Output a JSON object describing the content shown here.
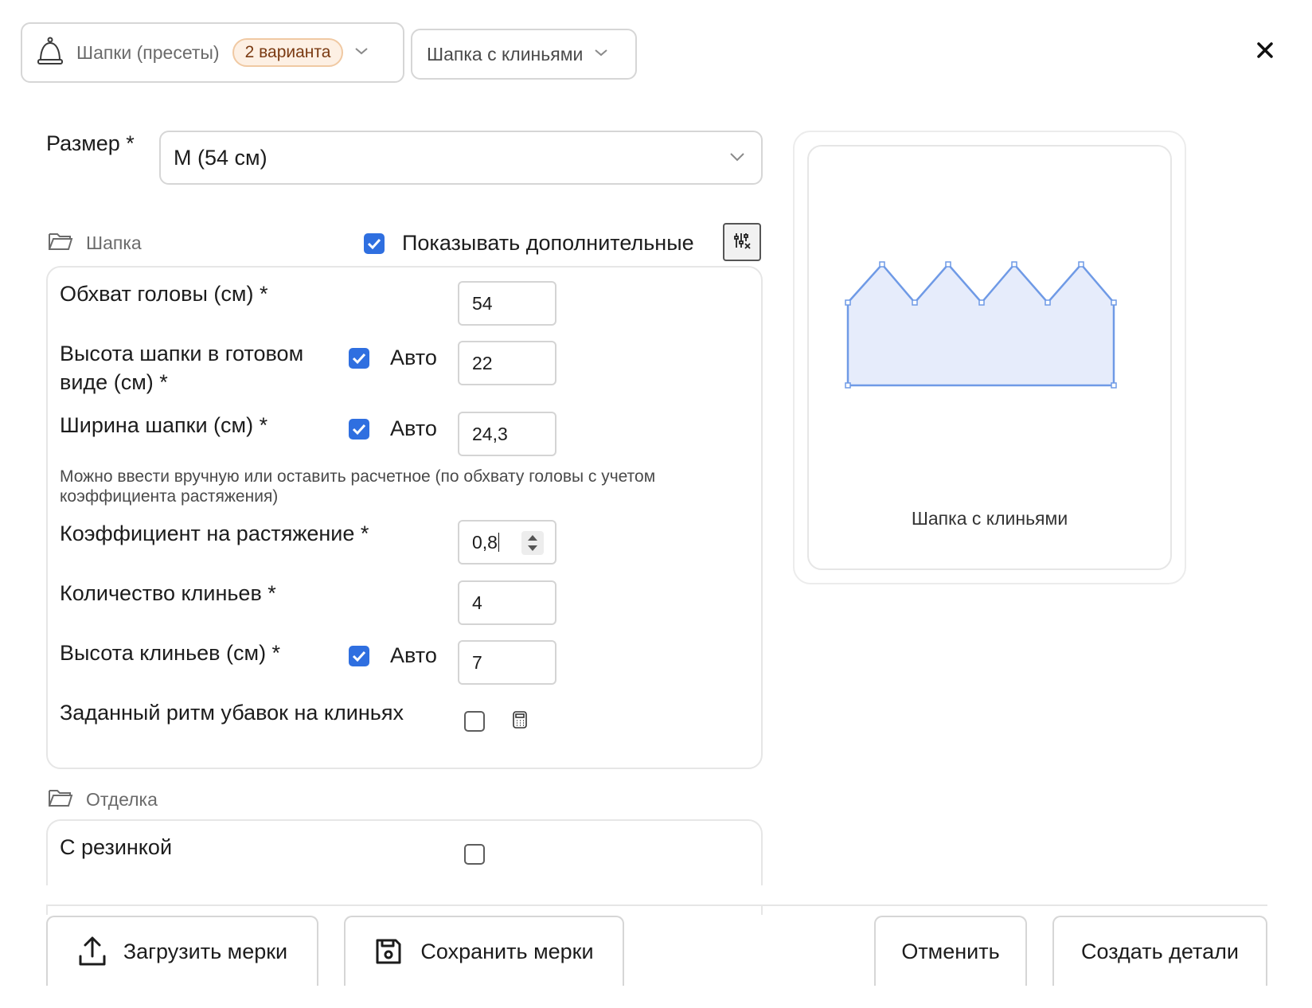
{
  "header": {
    "preset_label": "Шапки (пресеты)",
    "preset_badge": "2 варианта",
    "variant_label": "Шапка с клиньями"
  },
  "size": {
    "label": "Размер *",
    "value": "M (54 см)"
  },
  "section_hat": {
    "title": "Шапка",
    "show_extra_label": "Показывать дополнительные",
    "show_extra_checked": true
  },
  "fields": {
    "head_circ": {
      "label": "Обхват головы (см) *",
      "value": "54"
    },
    "hat_height": {
      "label": "Высота шапки в готовом виде (см) *",
      "auto_label": "Авто",
      "auto_checked": true,
      "value": "22"
    },
    "hat_width": {
      "label": "Ширина шапки (см) *",
      "auto_label": "Авто",
      "auto_checked": true,
      "value": "24,3"
    },
    "hint": "Можно ввести вручную или оставить расчетное (по обхвату головы с учетом коэффициента растяжения)",
    "stretch": {
      "label": "Коэффициент на растяжение *",
      "value": "0,8"
    },
    "wedge_count": {
      "label": "Количество клиньев *",
      "value": "4"
    },
    "wedge_height": {
      "label": "Высота клиньев (см) *",
      "auto_label": "Авто",
      "auto_checked": true,
      "value": "7"
    },
    "rhythm": {
      "label": "Заданный ритм убавок на клиньях",
      "checked": false
    }
  },
  "section_finish": {
    "title": "Отделка",
    "elastic_label": "С резинкой",
    "elastic_checked": false
  },
  "preview": {
    "caption": "Шапка с клиньями",
    "fill": "#e6ecfb",
    "stroke": "#6f9ae6"
  },
  "footer": {
    "load_label": "Загрузить мерки",
    "save_label": "Сохранить мерки",
    "cancel_label": "Отменить",
    "create_label": "Создать детали"
  },
  "colors": {
    "accent": "#2f6fe0",
    "badge_bg": "#fdf0e4",
    "badge_text": "#7a3a12"
  }
}
